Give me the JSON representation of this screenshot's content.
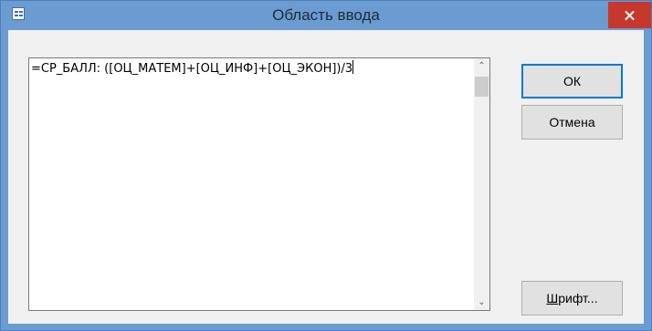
{
  "window": {
    "title": "Область ввода"
  },
  "editor": {
    "text": "=СР_БАЛЛ: ([ОЦ_МАТЕМ]+[ОЦ_ИНФ]+[ОЦ_ЭКОН])/3"
  },
  "buttons": {
    "ok_label": "ОК",
    "cancel_label": "Отмена",
    "font_label_accel": "Ш",
    "font_label_rest": "рифт..."
  },
  "colors": {
    "titlebar": "#6b9bd0",
    "close_button": "#c7382c",
    "dialog_background": "#f0f0f0",
    "default_button_border": "#0078d7"
  },
  "icons": {
    "app": "form-window-icon",
    "close": "close-icon",
    "scroll_up": "chevron-up-icon",
    "scroll_down": "chevron-down-icon"
  }
}
